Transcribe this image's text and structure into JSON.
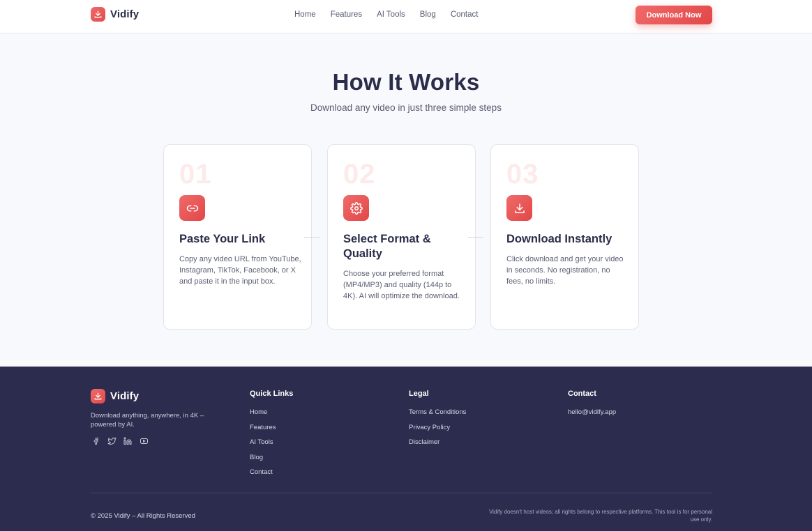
{
  "brand": {
    "name": "Vidify",
    "icon": "download-icon",
    "accent": "#e8504f"
  },
  "nav": {
    "items": [
      "Home",
      "Features",
      "AI Tools",
      "Blog",
      "Contact"
    ],
    "cta_label": "Download Now"
  },
  "hero": {
    "title": "How It Works",
    "subtitle": "Download any video in just three simple steps"
  },
  "steps": [
    {
      "number": "01",
      "icon": "link-icon",
      "title": "Paste Your Link",
      "description": "Copy any video URL from YouTube, Instagram, TikTok, Facebook, or X and paste it in the input box."
    },
    {
      "number": "02",
      "icon": "gear-icon",
      "title": "Select Format & Quality",
      "description": "Choose your preferred format (MP4/MP3) and quality (144p to 4K). AI will optimize the download."
    },
    {
      "number": "03",
      "icon": "download-icon",
      "title": "Download Instantly",
      "description": "Click download and get your video in seconds. No registration, no fees, no limits."
    }
  ],
  "footer": {
    "brand_name": "Vidify",
    "tagline": "Download anything, anywhere, in 4K – powered by AI.",
    "social_icons": [
      "facebook-icon",
      "twitter-icon",
      "linkedin-icon",
      "youtube-icon"
    ],
    "quick_links": {
      "heading": "Quick Links",
      "items": [
        "Home",
        "Features",
        "AI Tools",
        "Blog",
        "Contact"
      ]
    },
    "legal": {
      "heading": "Legal",
      "items": [
        "Terms & Conditions",
        "Privacy Policy",
        "Disclaimer"
      ]
    },
    "contact": {
      "heading": "Contact",
      "email": "hello@vidify.app"
    },
    "copyright": "© 2025 Vidify – All Rights Reserved",
    "disclaimer": "Vidify doesn't host videos; all rights belong to respective platforms. This tool is for personal use only."
  }
}
